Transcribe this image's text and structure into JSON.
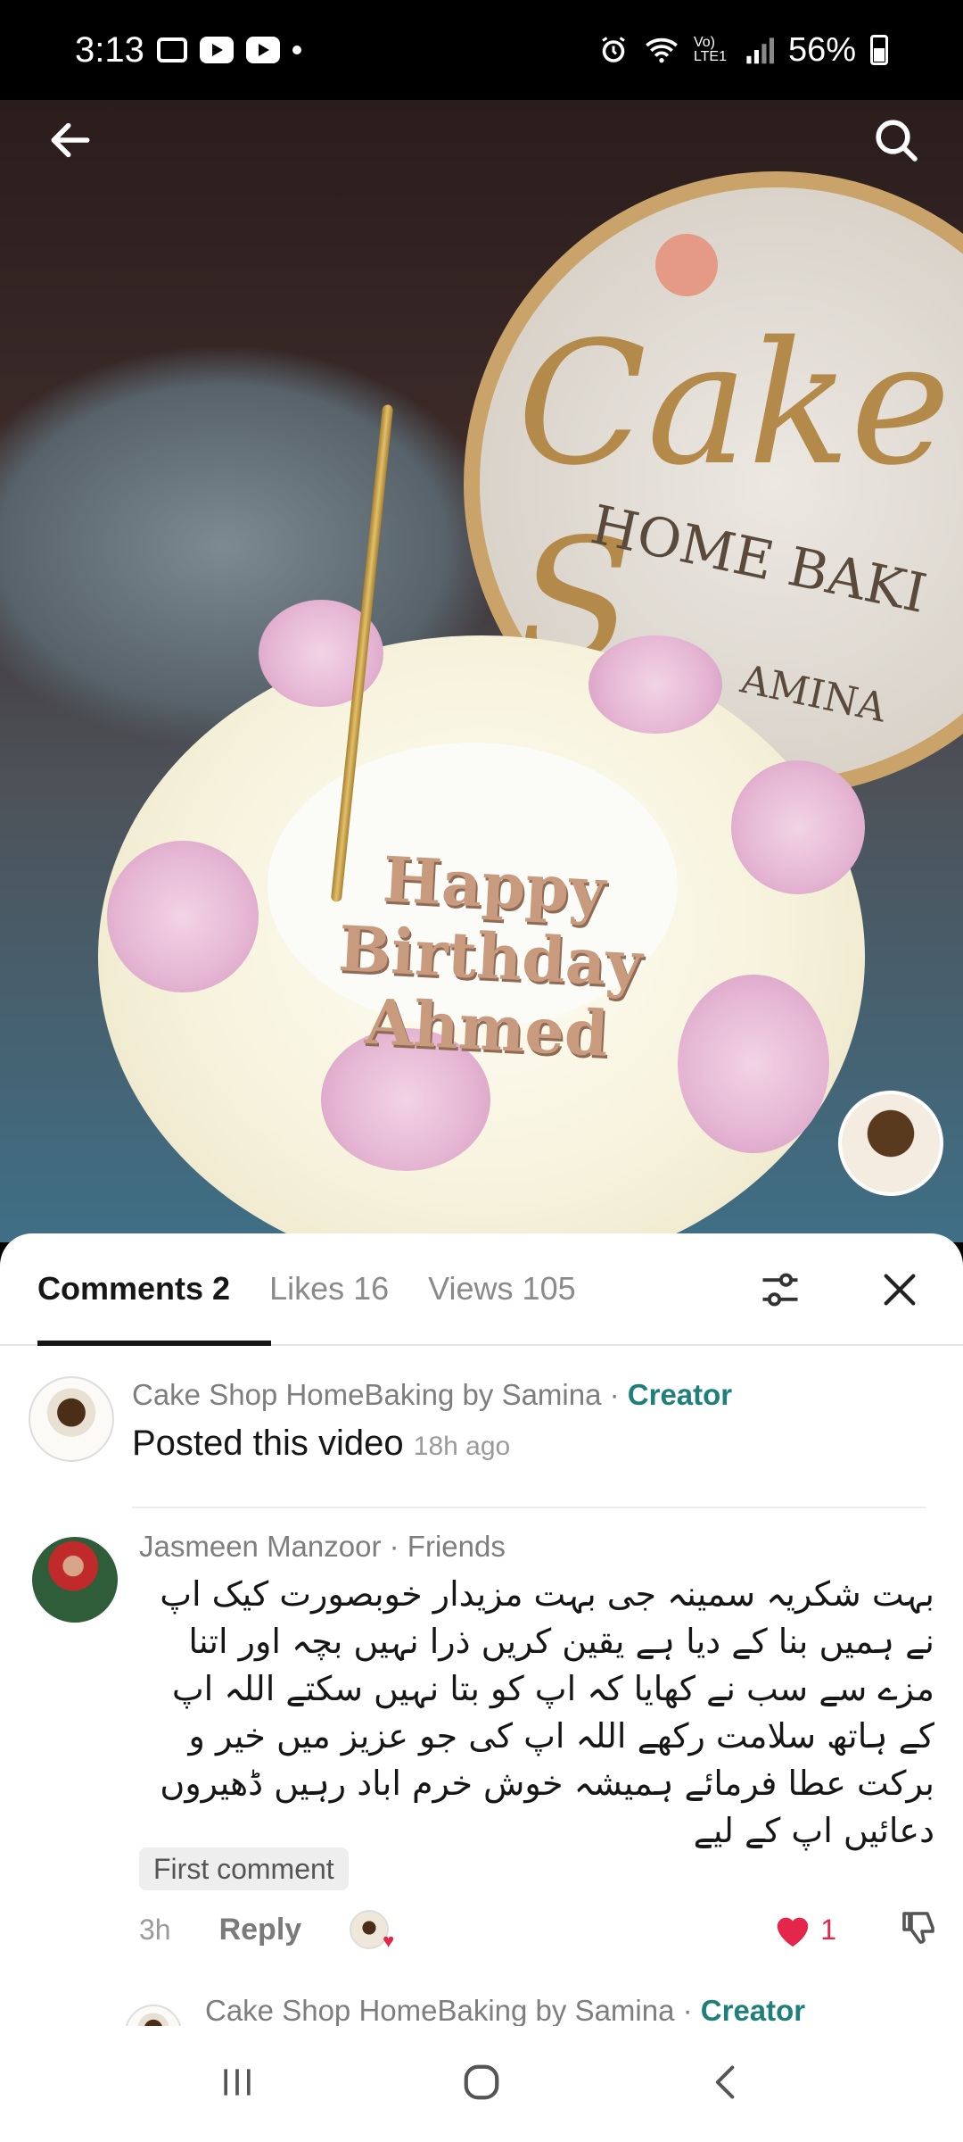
{
  "status_bar": {
    "time": "3:13",
    "signal_text": "Vo) LTE1",
    "battery": "56%",
    "icons": [
      "gallery-icon",
      "youtube-icon",
      "youtube-icon",
      "dot-icon",
      "alarm-icon",
      "wifi-icon",
      "signal-icon",
      "battery-icon"
    ]
  },
  "video": {
    "back_icon": "arrow-left-icon",
    "search_icon": "search-icon",
    "plaque_brand": "Cake S",
    "plaque_sub": "HOME BAKI",
    "plaque_sub2": "AMINA",
    "cake_text": [
      "Happy",
      "Birthday",
      "Ahmed"
    ]
  },
  "tabs": [
    {
      "label": "Comments",
      "count": "2",
      "active": true
    },
    {
      "label": "Likes",
      "count": "16",
      "active": false
    },
    {
      "label": "Views",
      "count": "105",
      "active": false
    }
  ],
  "tools": {
    "filter_icon": "sliders-icon",
    "close_icon": "close-icon"
  },
  "comments": [
    {
      "author": "Cake Shop HomeBaking by Samina",
      "separator": " · ",
      "tag": "Creator",
      "text": "Posted this video",
      "time": "18h ago"
    },
    {
      "author": "Jasmeen Manzoor",
      "separator": " · ",
      "tag": "Friends",
      "text": "بہت شکریہ سمینہ جی بہت مزیدار خوبصورت کیک اپ نے ہمیں بنا کے دیا ہے یقین کریں ذرا نہیں بچہ اور اتنا مزے سے سب نے کھایا کہ اپ کو بتا نہیں سکتے اللہ اپ کے ہاتھ سلامت رکھے اللہ اپ کی جو عزیز میں خیر و برکت عطا فرمائے ہمیشہ خوش خرم اباد رہیں ڈھیروں دعائیں اپ کے لیے",
      "badge": "First comment",
      "time": "3h",
      "reply_label": "Reply",
      "likes": "1"
    },
    {
      "author": "Cake Shop HomeBaking by Samina",
      "separator": " · ",
      "tag": "Creator"
    }
  ],
  "colors": {
    "creator": "#1f7f7a",
    "like": "#e3264a",
    "text": "#161616",
    "muted": "#8a8a8a"
  },
  "navbar": {
    "icons": [
      "recents-icon",
      "home-icon",
      "back-icon"
    ]
  }
}
